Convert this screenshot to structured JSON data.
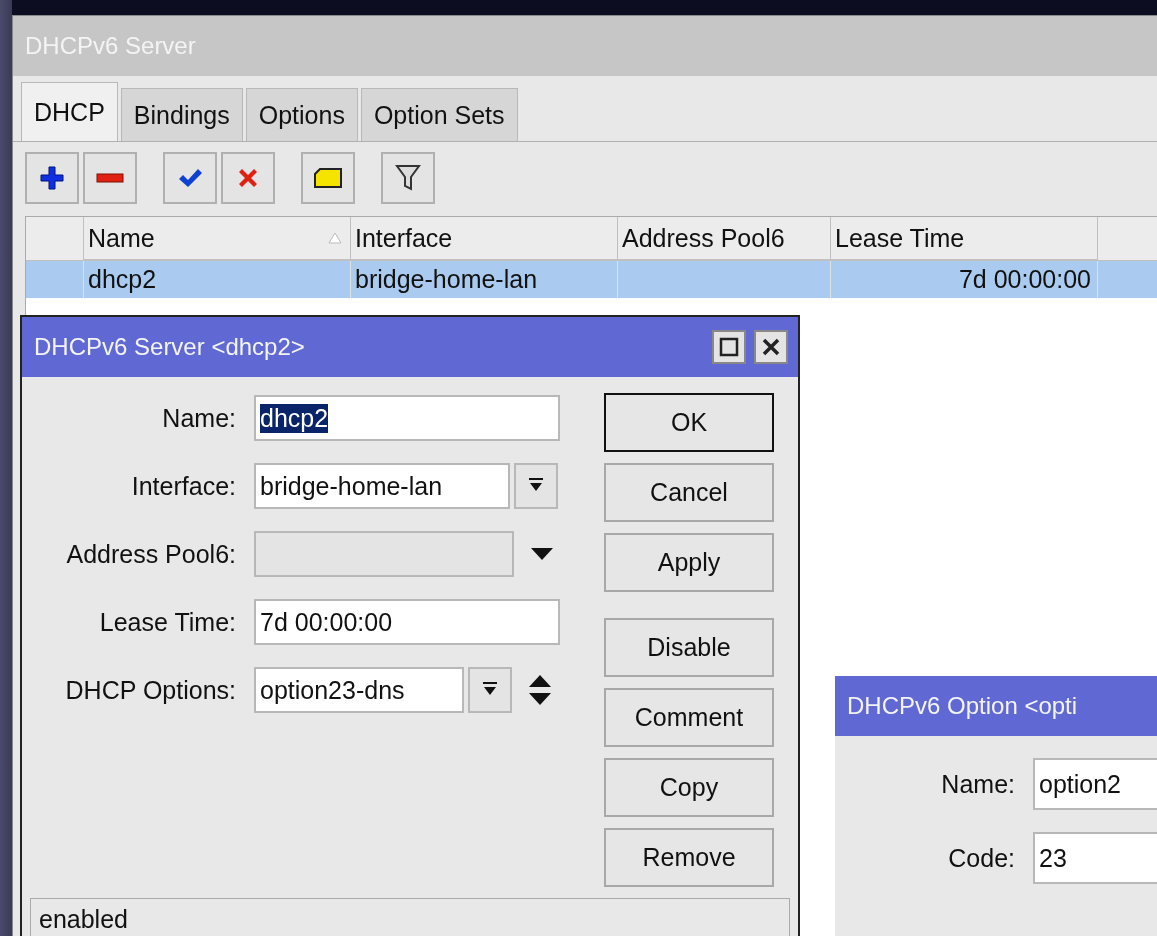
{
  "main_window": {
    "title": "DHCPv6 Server",
    "tabs": [
      {
        "label": "DHCP",
        "selected": true
      },
      {
        "label": "Bindings",
        "selected": false
      },
      {
        "label": "Options",
        "selected": false
      },
      {
        "label": "Option Sets",
        "selected": false
      }
    ],
    "table": {
      "columns": [
        {
          "label": "Name",
          "sorted": true
        },
        {
          "label": "Interface",
          "sorted": false
        },
        {
          "label": "Address Pool6",
          "sorted": false
        },
        {
          "label": "Lease Time",
          "sorted": false
        }
      ],
      "rows": [
        {
          "selected": true,
          "cells": [
            "dhcp2",
            "bridge-home-lan",
            null,
            "7d 00:00:00"
          ]
        }
      ]
    }
  },
  "dialog": {
    "title": "DHCPv6 Server <dhcp2>",
    "fields": [
      {
        "kind": "text",
        "label": "Name:",
        "value": "dhcp2",
        "value_selected": true,
        "disabled": false
      },
      {
        "kind": "dropdown",
        "label": "Interface:",
        "value": "bridge-home-lan",
        "value_selected": false,
        "disabled": false
      },
      {
        "kind": "dropdown",
        "label": "Address Pool6:",
        "disabled": true
      },
      {
        "kind": "text",
        "label": "Lease Time:",
        "value": "7d 00:00:00",
        "value_selected": false,
        "disabled": false
      },
      {
        "kind": "multi",
        "label": "DHCP Options:",
        "value": "option23-dns",
        "value_selected": false,
        "disabled": false
      }
    ],
    "button_groups": [
      {
        "buttons": [
          {
            "label": "OK",
            "default": true
          },
          {
            "label": "Cancel",
            "default": false
          },
          {
            "label": "Apply",
            "default": false
          }
        ]
      },
      {
        "buttons": [
          {
            "label": "Disable",
            "default": false
          },
          {
            "label": "Comment",
            "default": false
          },
          {
            "label": "Copy",
            "default": false
          },
          {
            "label": "Remove",
            "default": false
          }
        ]
      }
    ],
    "status": "enabled"
  },
  "option_dialog": {
    "title": "DHCPv6 Option <opti",
    "fields": [
      {
        "label": "Name:",
        "value": "option2"
      },
      {
        "label": "Code:",
        "value": "23"
      }
    ]
  }
}
